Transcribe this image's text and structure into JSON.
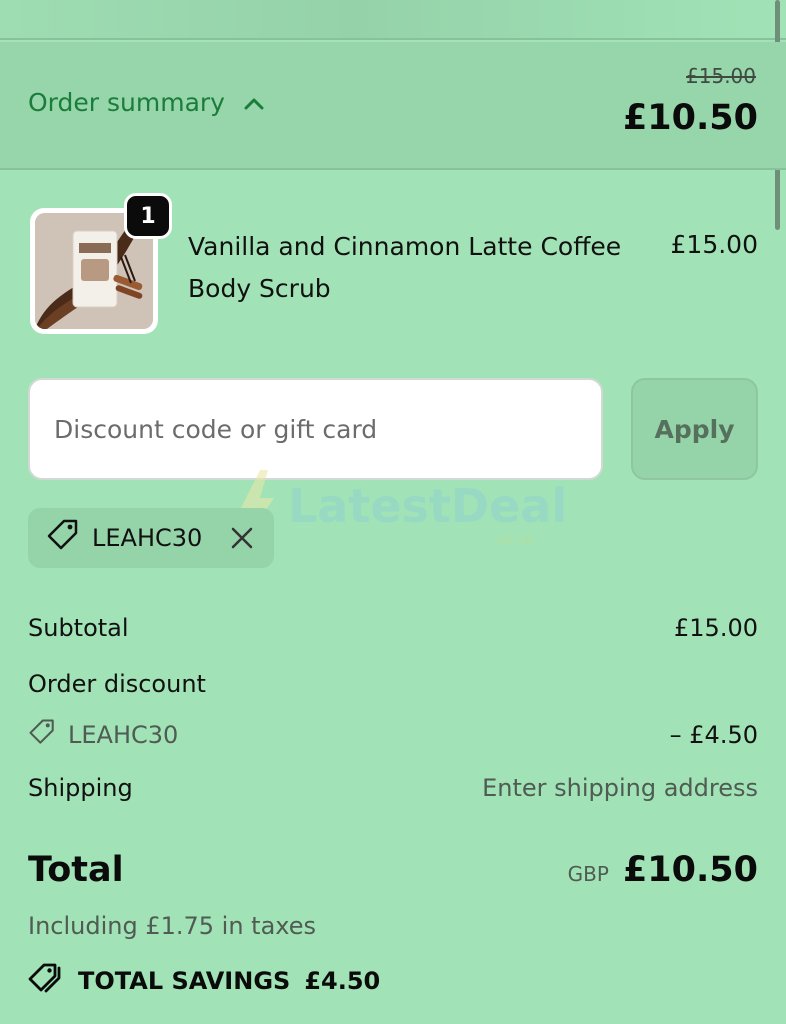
{
  "summary": {
    "toggle_label": "Order summary",
    "original_total": "£15.00",
    "total": "£10.50"
  },
  "product": {
    "quantity": "1",
    "name": "Vanilla and Cinnamon Latte Coffee Body Scrub",
    "price": "£15.00"
  },
  "discount": {
    "placeholder": "Discount code or gift card",
    "value": "",
    "apply_label": "Apply",
    "applied_code": "LEAHC30"
  },
  "watermark": {
    "text": "LatestDeals",
    "subtext": ".co.uk"
  },
  "lines": {
    "subtotal_label": "Subtotal",
    "subtotal_value": "£15.00",
    "order_discount_label": "Order discount",
    "discount_code": "LEAHC30",
    "discount_value": "– £4.50",
    "shipping_label": "Shipping",
    "shipping_value": "Enter shipping address"
  },
  "total": {
    "label": "Total",
    "currency": "GBP",
    "amount": "£10.50",
    "taxes_note": "Including £1.75 in taxes"
  },
  "savings": {
    "label": "TOTAL SAVINGS",
    "amount": "£4.50"
  },
  "colors": {
    "background": "#a1e3b6",
    "summary_bar": "#97d5ab",
    "accent_link": "#1a7d3a",
    "text": "#0f0f0f",
    "muted_text": "#4f5b53"
  },
  "icons": [
    "chevron-up-icon",
    "tag-icon",
    "close-icon",
    "tags-icon"
  ]
}
